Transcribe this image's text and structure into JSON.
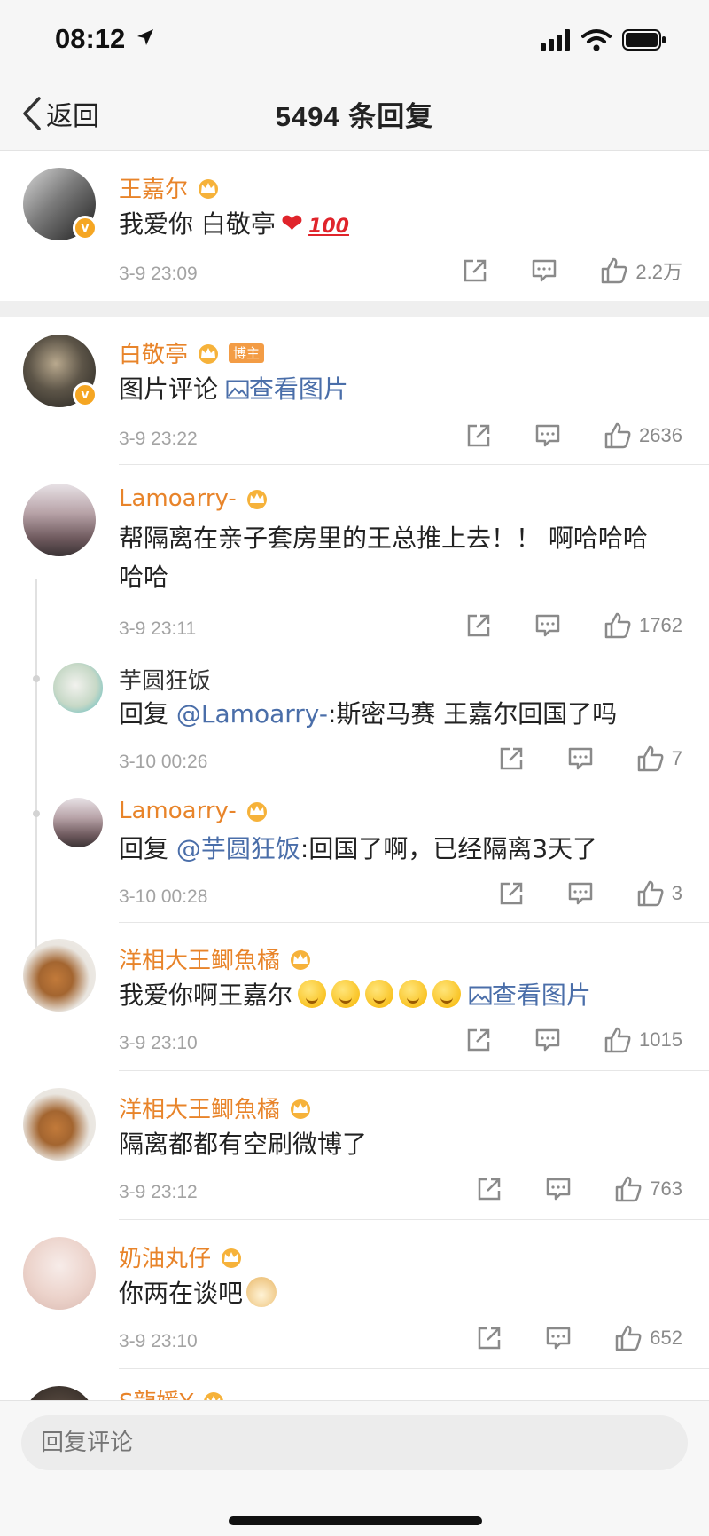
{
  "status_bar": {
    "time": "08:12"
  },
  "nav": {
    "back_label": "返回",
    "title": "5494 条回复"
  },
  "comments": [
    {
      "user": "王嘉尔",
      "text": "我爱你 白敬亭",
      "time": "3-9 23:09",
      "likes": "2.2万"
    },
    {
      "user": "白敬亭",
      "tag": "博主",
      "text": "图片评论",
      "image_link": "查看图片",
      "time": "3-9 23:22",
      "likes": "2636"
    },
    {
      "user": "Lamoarry-",
      "text_line1": "帮隔离在亲子套房里的王总推上去！！ 啊哈哈哈",
      "text_line2": "哈哈",
      "time": "3-9 23:11",
      "likes": "1762"
    },
    {
      "user": "芋圆狂饭",
      "reply_prefix": "回复 ",
      "mention": "@Lamoarry-",
      "text": ":斯密马赛 王嘉尔回国了吗",
      "time": "3-10 00:26",
      "likes": "7"
    },
    {
      "user": "Lamoarry-",
      "reply_prefix": "回复 ",
      "mention": "@芋圆狂饭",
      "text": ":回国了啊，已经隔离3天了",
      "time": "3-10 00:28",
      "likes": "3"
    },
    {
      "user": "洋相大王鲫魚橘",
      "text": "我爱你啊王嘉尔",
      "image_link": "查看图片",
      "time": "3-9 23:10",
      "likes": "1015"
    },
    {
      "user": "洋相大王鲫魚橘",
      "text": "隔离都都有空刷微博了",
      "time": "3-9 23:12",
      "likes": "763"
    },
    {
      "user": "奶油丸仔",
      "text": "你两在谈吧",
      "time": "3-9 23:10",
      "likes": "652"
    },
    {
      "user": "S龍媛Y"
    }
  ],
  "input": {
    "placeholder": "回复评论"
  },
  "colors": {
    "username": "#e8842a",
    "link": "#4a6ea9",
    "meta": "#a3a3a3",
    "heart": "#e0242b"
  }
}
